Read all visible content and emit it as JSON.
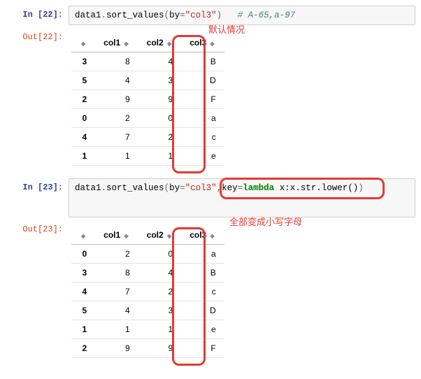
{
  "cell22": {
    "in_label": "In [22]:",
    "out_label": "Out[22]:",
    "code": {
      "ident1": "data1",
      "dot": ".",
      "fn": "sort_values",
      "lp": "(",
      "kw_by": "by",
      "eq": "=",
      "str_col": "\"col3\"",
      "rp": ")",
      "spacer": "   ",
      "comment": "# A-65,a-97"
    },
    "annot": "默认情况",
    "headers": [
      "col1",
      "col2",
      "col3"
    ],
    "rows": [
      {
        "idx": "3",
        "c1": "8",
        "c2": "4",
        "c3": "B"
      },
      {
        "idx": "5",
        "c1": "4",
        "c2": "3",
        "c3": "D"
      },
      {
        "idx": "2",
        "c1": "9",
        "c2": "9",
        "c3": "F"
      },
      {
        "idx": "0",
        "c1": "2",
        "c2": "0",
        "c3": "a"
      },
      {
        "idx": "4",
        "c1": "7",
        "c2": "2",
        "c3": "c"
      },
      {
        "idx": "1",
        "c1": "1",
        "c2": "1",
        "c3": "e"
      }
    ]
  },
  "cell23": {
    "in_label": "In [23]:",
    "out_label": "Out[23]:",
    "code": {
      "ident1": "data1",
      "dot": ".",
      "fn": "sort_values",
      "lp": "(",
      "kw_by": "by",
      "eq": "=",
      "str_col": "\"col3\"",
      "comma": ",",
      "kw_key": "key",
      "eq2": "=",
      "kw_lambda": "lambda",
      "sp": " ",
      "lam_body": "x:x.str.lower()",
      "rp": ")"
    },
    "annot": "全部变成小写字母",
    "headers": [
      "col1",
      "col2",
      "col3"
    ],
    "rows": [
      {
        "idx": "0",
        "c1": "2",
        "c2": "0",
        "c3": "a"
      },
      {
        "idx": "3",
        "c1": "8",
        "c2": "4",
        "c3": "B"
      },
      {
        "idx": "4",
        "c1": "7",
        "c2": "2",
        "c3": "c"
      },
      {
        "idx": "5",
        "c1": "4",
        "c2": "3",
        "c3": "D"
      },
      {
        "idx": "1",
        "c1": "1",
        "c2": "1",
        "c3": "e"
      },
      {
        "idx": "2",
        "c1": "9",
        "c2": "9",
        "c3": "F"
      }
    ]
  },
  "sort_glyph": "◆"
}
